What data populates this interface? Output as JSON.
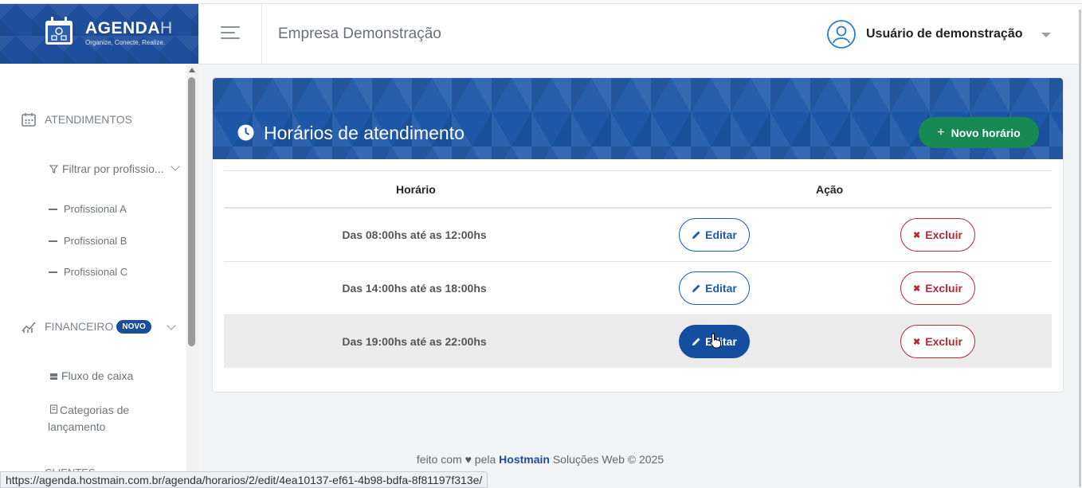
{
  "brand": {
    "name": "AGENDA",
    "name_suffix": "H",
    "tagline": "Organize, Conecte, Realize."
  },
  "header": {
    "company": "Empresa Demonstração",
    "user_name": "Usuário de demonstração"
  },
  "sidebar": {
    "atendimentos_label": "ATENDIMENTOS",
    "filter_label": "Filtrar por profissio...",
    "professionals": [
      "Profissional A",
      "Profissional B",
      "Profissional C"
    ],
    "financeiro_label": "FINANCEIRO",
    "financeiro_badge": "NOVO",
    "fluxo_label": "Fluxo de caixa",
    "categorias_label": "Categorias de lançamento",
    "clientes_label": "CLIENTES"
  },
  "page": {
    "title": "Horários de atendimento",
    "new_button": "Novo horário",
    "columns": [
      "Horário",
      "Ação"
    ],
    "rows": [
      {
        "time": "Das 08:00hs até as 12:00hs"
      },
      {
        "time": "Das 14:00hs até as 18:00hs"
      },
      {
        "time": "Das 19:00hs até as 22:00hs"
      }
    ],
    "edit_label": "Editar",
    "delete_label": "Excluir"
  },
  "footer": {
    "prefix": "feito com",
    "middle": "pela",
    "brand": "Hostmain",
    "suffix": "Soluções Web © 2025"
  },
  "status_url": "https://agenda.hostmain.com.br/agenda/horarios/2/edit/4ea10137-ef61-4b98-bdfa-8f81197f313e/",
  "colors": {
    "primary": "#1d57a8",
    "success": "#178a53",
    "danger": "#b42a37"
  }
}
